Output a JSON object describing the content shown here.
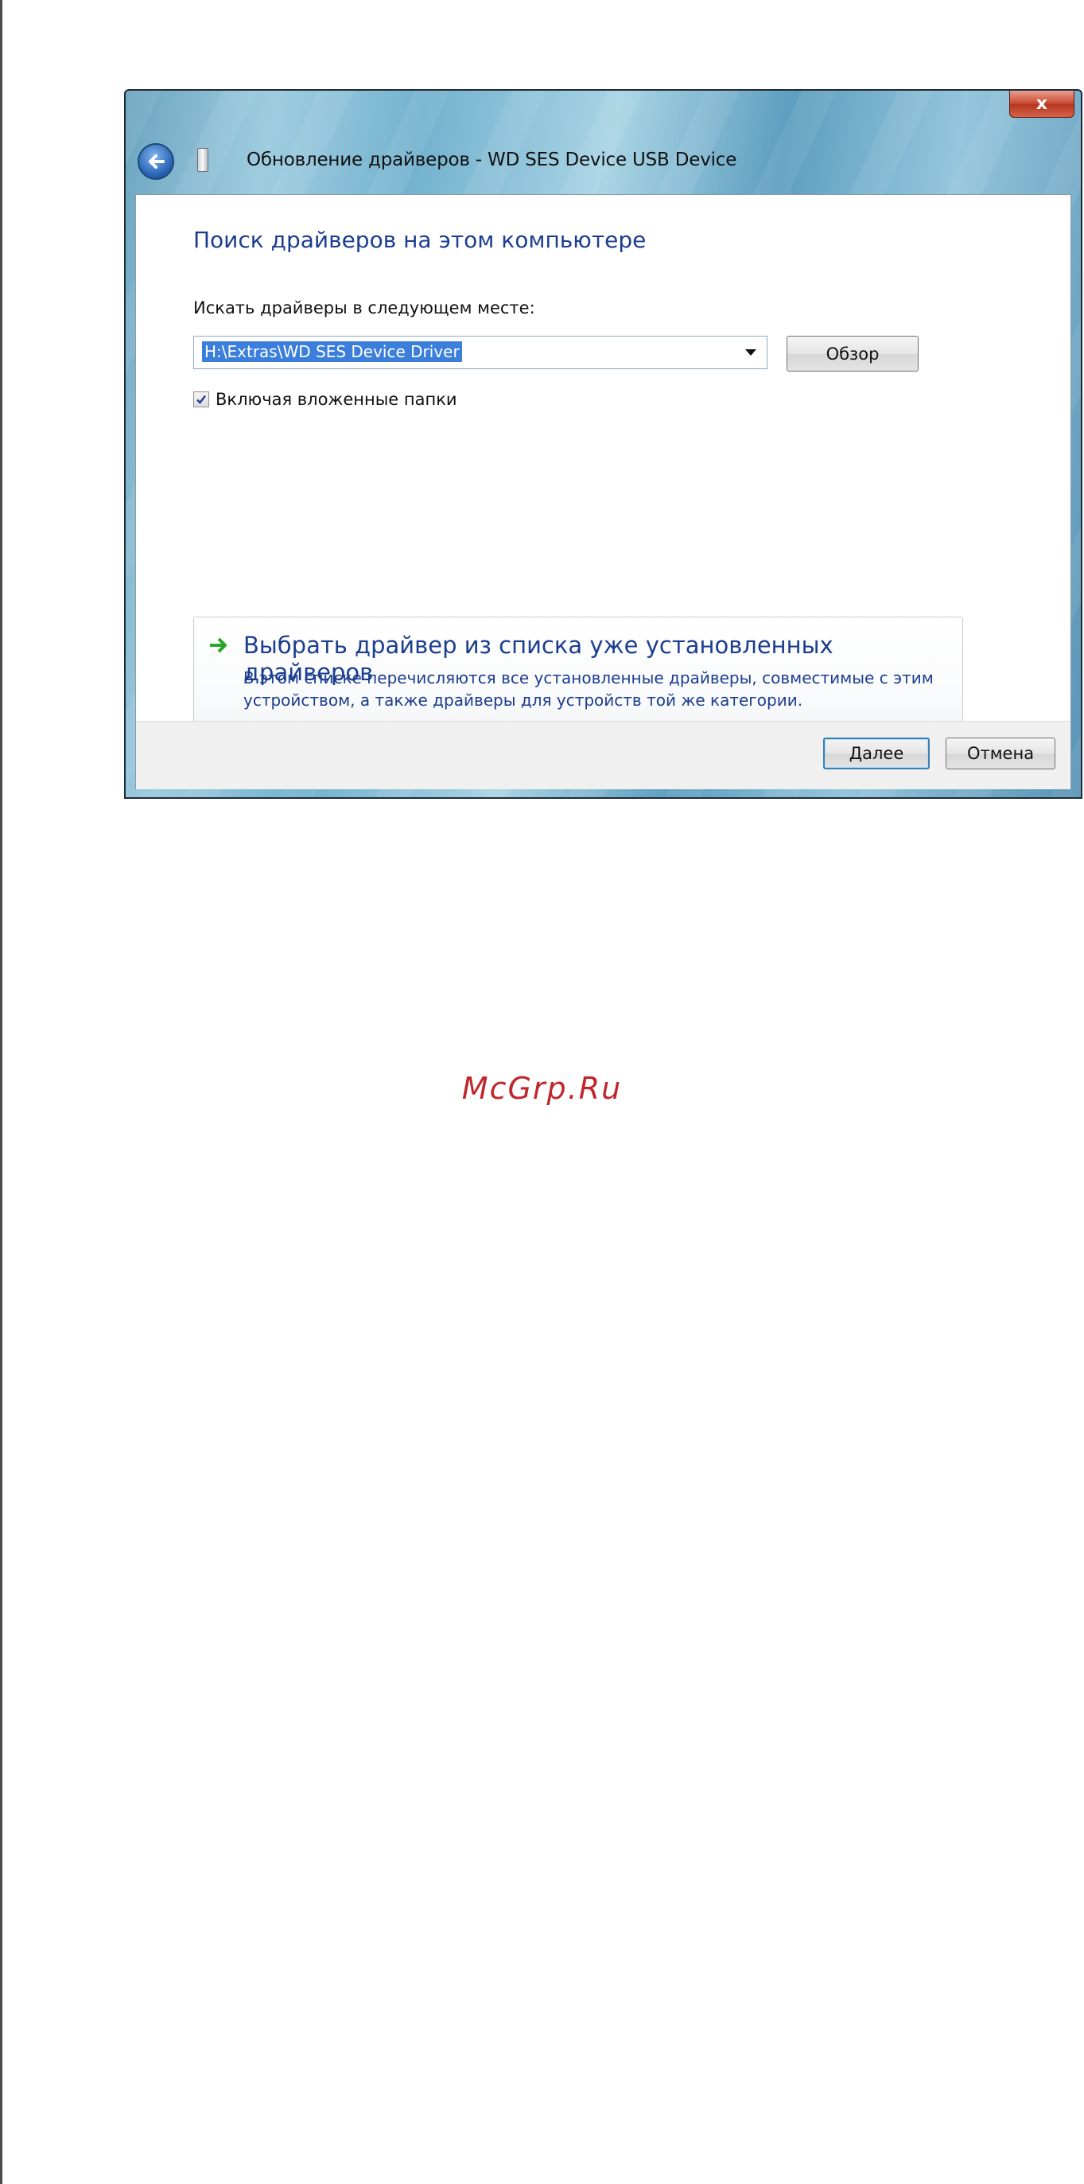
{
  "window": {
    "title": "Обновление драйверов - WD SES Device USB Device",
    "close_label": "x"
  },
  "main": {
    "heading": "Поиск драйверов на этом компьютере",
    "search_label": "Искать драйверы в следующем месте:",
    "path_value": "H:\\Extras\\WD SES Device Driver",
    "browse_label": "Обзор",
    "include_subfolders_label": "Включая вложенные папки",
    "include_subfolders_checked": true
  },
  "pick_option": {
    "title": "Выбрать драйвер из списка уже установленных драйверов",
    "description": "В этом списке перечисляются все установленные драйверы, совместимые с этим устройством, а также драйверы для устройств той же категории."
  },
  "footer": {
    "next_label": "Далее",
    "cancel_label": "Отмена"
  },
  "watermark": {
    "text": "McGrp.Ru"
  }
}
